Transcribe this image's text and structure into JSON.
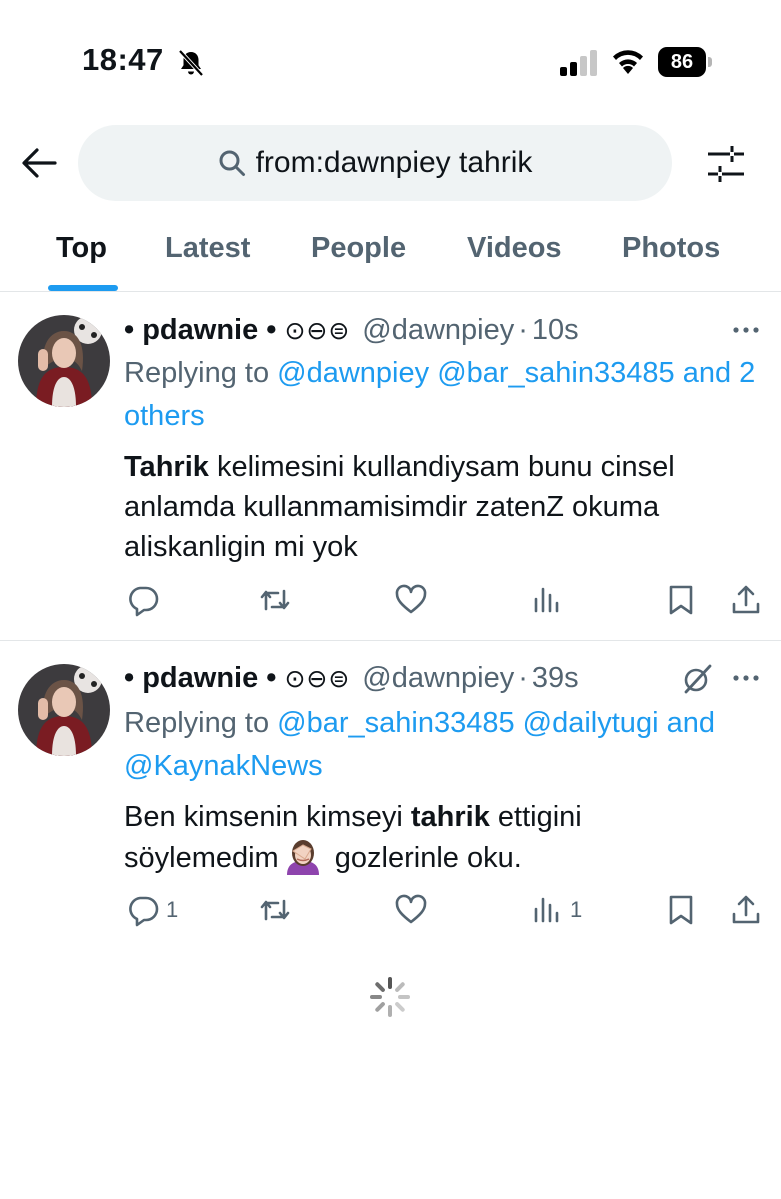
{
  "status_bar": {
    "time": "18:47",
    "battery": "86"
  },
  "search": {
    "query": "from:dawnpiey tahrik"
  },
  "tabs": [
    {
      "label": "Top",
      "active": true
    },
    {
      "label": "Latest",
      "active": false
    },
    {
      "label": "People",
      "active": false
    },
    {
      "label": "Videos",
      "active": false
    },
    {
      "label": "Photos",
      "active": false
    }
  ],
  "tweets": [
    {
      "display_name": "• pdawnie •",
      "name_symbols": "⊙⊖⊜",
      "handle": "@dawnpiey",
      "separator": "·",
      "time": "10s",
      "replying_prefix": "Replying to",
      "mention_1": "@dawnpiey",
      "mention_2": "@bar_sahin33485",
      "mention_3": "and 2 others",
      "text_bold": "Tahrik",
      "text_rest": " kelimesini kullandiysam bunu cinsel anlamda kullanmamisimdir zatenZ okuma aliskanligin mi yok",
      "reply_count": "",
      "view_count": ""
    },
    {
      "display_name": "• pdawnie •",
      "name_symbols": "⊙⊖⊜",
      "handle": "@dawnpiey",
      "separator": "·",
      "time": "39s",
      "replying_prefix": "Replying to",
      "mention_1": "@bar_sahin33485",
      "mention_2": "@dailytugi",
      "mention_and": "and",
      "mention_3": "@KaynakNews",
      "text_before": "Ben kimsenin kimseyi ",
      "text_bold": "tahrik",
      "text_after_1": " ettigini söylemedim",
      "text_after_2": " gozlerinle oku.",
      "reply_count": "1",
      "view_count": "1"
    }
  ],
  "colors": {
    "accent": "#1d9bf0",
    "secondary_text": "#536471",
    "primary_text": "#0f1419",
    "search_bg": "#eff3f4"
  },
  "icons": [
    "bell-off-icon",
    "signal-icon",
    "wifi-icon",
    "battery-icon",
    "back-arrow-icon",
    "search-icon",
    "filter-icon",
    "more-icon",
    "grok-icon",
    "reply-icon",
    "retweet-icon",
    "like-icon",
    "views-icon",
    "bookmark-icon",
    "share-icon",
    "loading-spinner-icon",
    "face-palm-emoji"
  ]
}
